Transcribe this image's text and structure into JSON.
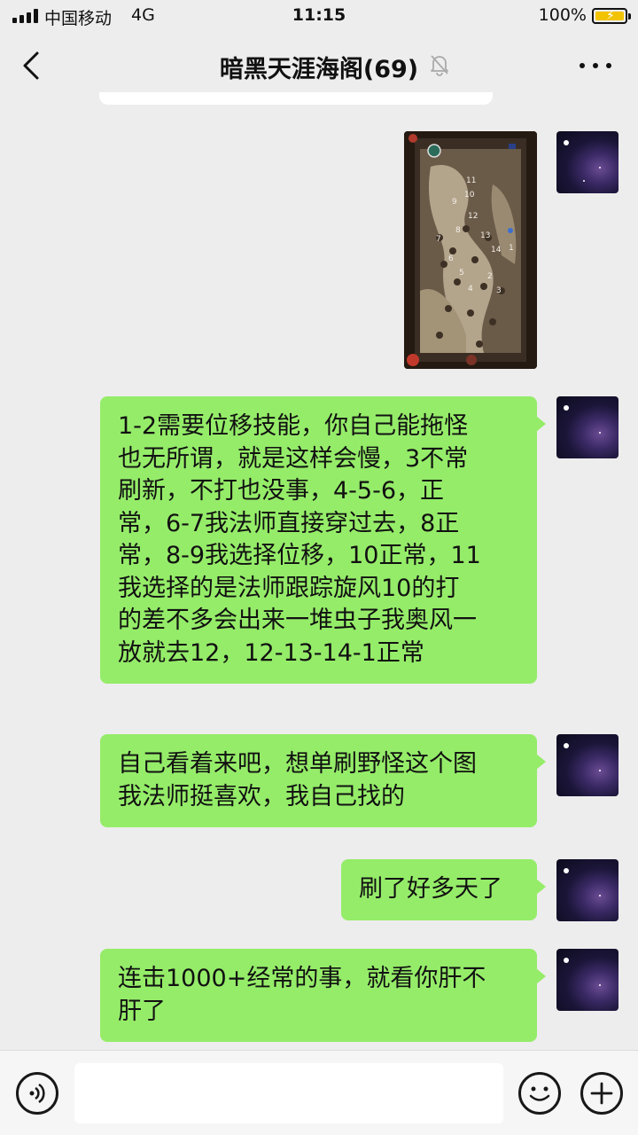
{
  "status_bar": {
    "carrier": "中国移动",
    "network": "4G",
    "time": "11:15",
    "battery": "100%"
  },
  "nav": {
    "title": "暗黑天涯海阁(69)",
    "back_icon": "chevron-left-icon",
    "mute_icon": "bell-off-icon",
    "more_icon": "more-dots-icon"
  },
  "map": {
    "numbers": [
      "11",
      "10",
      "9",
      "12",
      "8",
      "13",
      "7",
      "14",
      "1",
      "6",
      "5",
      "2",
      "4",
      "3"
    ]
  },
  "messages": [
    {
      "type": "image",
      "sender": "self"
    },
    {
      "type": "text",
      "sender": "self",
      "lines": [
        "1-2需要位移技能，你自己能拖怪",
        "也无所谓，就是这样会慢，3不常",
        "刷新，不打也没事，4-5-6，正",
        "常，6-7我法师直接穿过去，8正",
        "常，8-9我选择位移，10正常，11",
        "我选择的是法师跟踪旋风10的打",
        "的差不多会出来一堆虫子我奥风一",
        "放就去12，12-13-14-1正常"
      ]
    },
    {
      "type": "text",
      "sender": "self",
      "lines": [
        "自己看着来吧，想单刷野怪这个图",
        "我法师挺喜欢，我自己找的"
      ]
    },
    {
      "type": "text",
      "sender": "self",
      "lines": [
        "刷了好多天了"
      ]
    },
    {
      "type": "text",
      "sender": "self",
      "lines": [
        "连击1000+经常的事，就看你肝不",
        "肝了"
      ]
    }
  ],
  "input_bar": {
    "voice_icon": "voice-icon",
    "emoji_icon": "emoji-icon",
    "plus_icon": "plus-icon"
  },
  "colors": {
    "bubble": "#95ec69",
    "background": "#ededed"
  }
}
